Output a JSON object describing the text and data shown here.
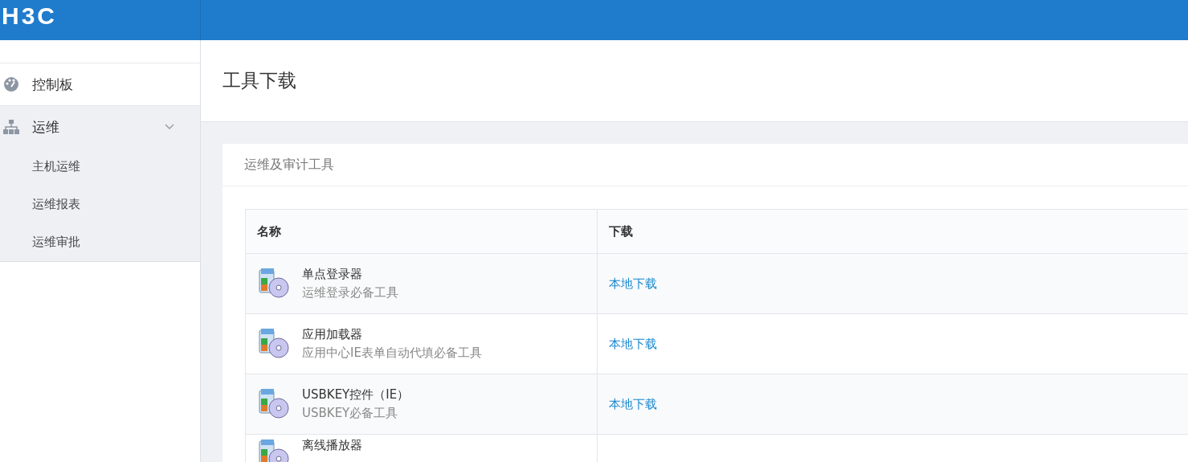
{
  "header": {
    "logo": "H3C"
  },
  "sidebar": {
    "items": [
      {
        "label": "控制板",
        "kind": "dashboard"
      },
      {
        "label": "运维",
        "kind": "tree",
        "expanded": true,
        "children": [
          {
            "label": "主机运维"
          },
          {
            "label": "运维报表"
          },
          {
            "label": "运维审批"
          }
        ]
      }
    ]
  },
  "page": {
    "title": "工具下载"
  },
  "card": {
    "title": "运维及审计工具",
    "table": {
      "columns": [
        "名称",
        "下载"
      ],
      "rows": [
        {
          "name": "单点登录器",
          "description": "运维登录必备工具",
          "download": "本地下载"
        },
        {
          "name": "应用加载器",
          "description": "应用中心IE表单自动代填必备工具",
          "download": "本地下载"
        },
        {
          "name": "USBKEY控件（IE）",
          "description": "USBKEY必备工具",
          "download": "本地下载"
        },
        {
          "name": "离线播放器"
        }
      ]
    }
  }
}
